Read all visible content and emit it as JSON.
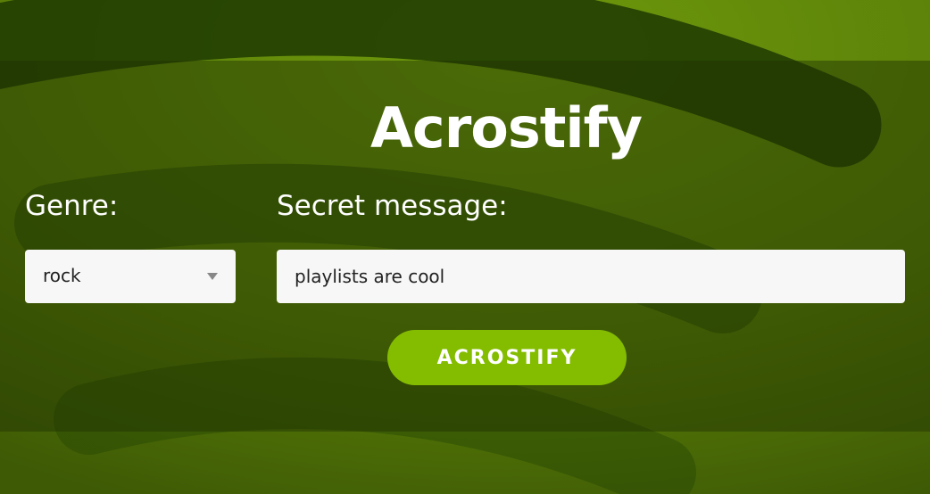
{
  "theme": {
    "accent": "#84bd00",
    "background": "#5a7d0a",
    "field_background": "#f7f7f7",
    "text_light": "#ffffff",
    "text_dark": "#222222"
  },
  "header": {
    "title": "Acrostify"
  },
  "form": {
    "genre_label": "Genre:",
    "genre_value": "rock",
    "message_label": "Secret message:",
    "message_value": "playlists are cool",
    "submit_label": "ACROSTIFY"
  },
  "icons": {
    "dropdown": "chevron-down-icon"
  }
}
